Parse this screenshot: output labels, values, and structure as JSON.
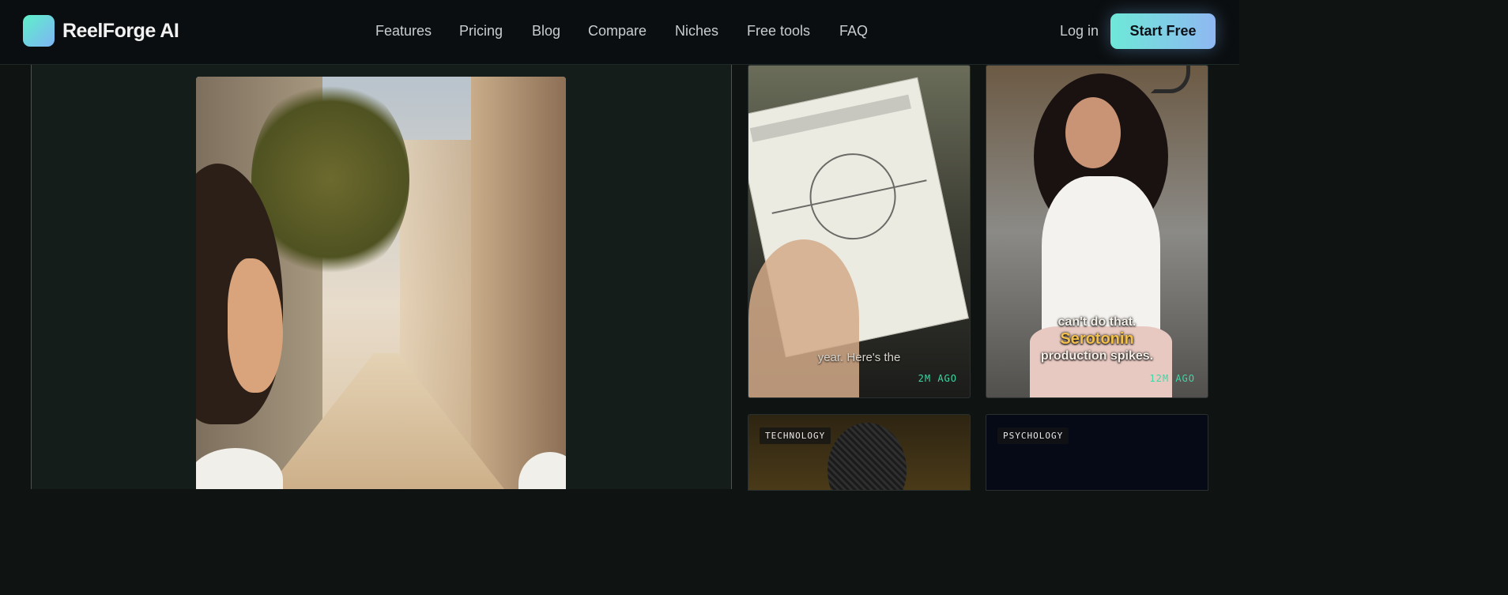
{
  "brand": {
    "name": "ReelForge AI",
    "colors": {
      "accent_start": "#6ee8d8",
      "accent_end": "#8fb8f2",
      "timestamp": "#3fd6a6"
    }
  },
  "nav": {
    "links": [
      "Features",
      "Pricing",
      "Blog",
      "Compare",
      "Niches",
      "Free tools",
      "FAQ"
    ],
    "login_label": "Log in",
    "cta_label": "Start Free"
  },
  "cards": [
    {
      "subtitle": "year. Here's the",
      "timestamp": "2M AGO"
    },
    {
      "subtitle_line1": "can't do that.",
      "subtitle_highlight": "Serotonin",
      "subtitle_line3": "production spikes.",
      "timestamp": "12M AGO"
    },
    {
      "tag": "TECHNOLOGY"
    },
    {
      "tag": "PSYCHOLOGY"
    }
  ],
  "icons": {
    "logo": "reelforge-logo-icon"
  }
}
